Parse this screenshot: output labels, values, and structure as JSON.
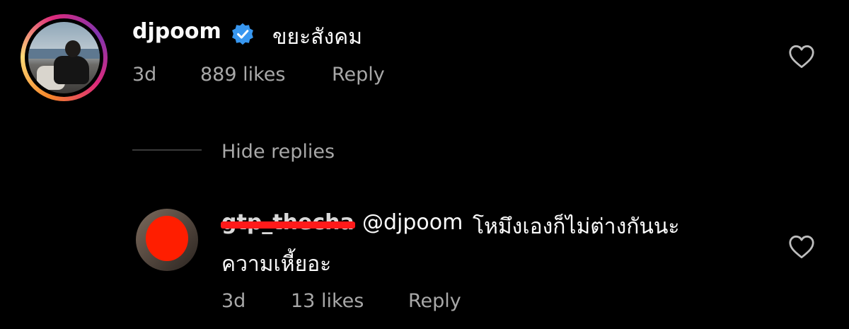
{
  "comment": {
    "username": "djpoom",
    "verified_icon": "verified-badge-icon",
    "text": "ขยะสังคม",
    "time": "3d",
    "likes": "889 likes",
    "reply_label": "Reply",
    "like_icon": "heart-outline-icon"
  },
  "hide_replies_label": "Hide replies",
  "reply": {
    "username": "gtp_thecha",
    "mention": "@djpoom",
    "text_line1": "โหมึงเองก็ไม่ต่างกันนะ",
    "text_line2": "ความเหี้ยอะ",
    "time": "3d",
    "likes": "13 likes",
    "reply_label": "Reply",
    "like_icon": "heart-outline-icon"
  },
  "colors": {
    "background": "#000000",
    "text": "#fafafa",
    "muted": "#a8a8a8",
    "verified": "#3897f0",
    "redaction": "#ff1e00"
  }
}
